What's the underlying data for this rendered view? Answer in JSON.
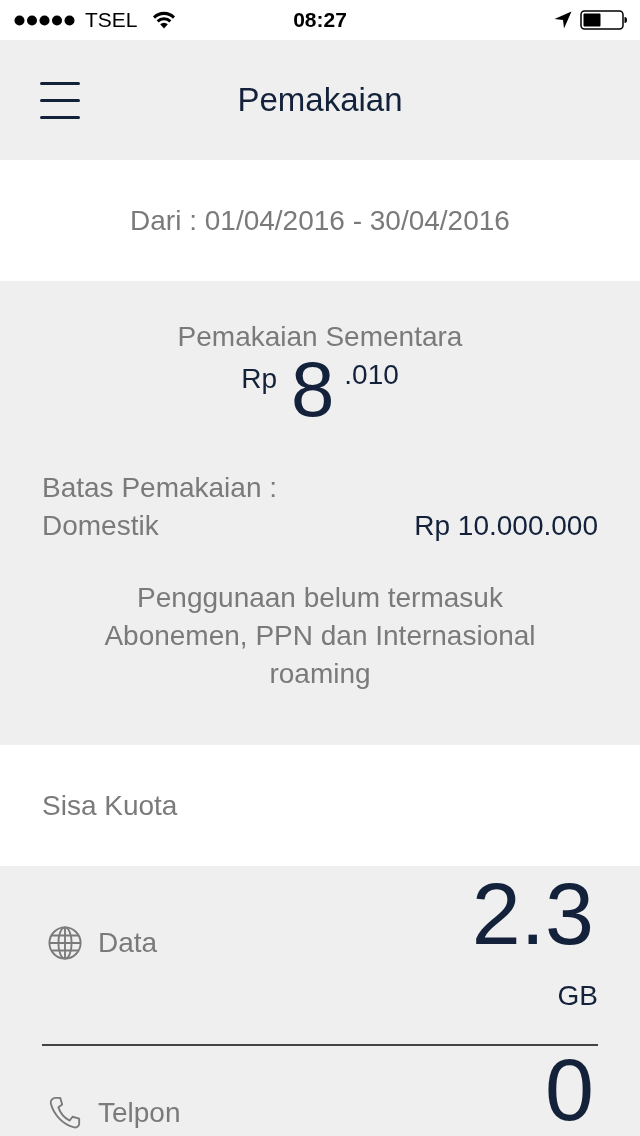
{
  "status_bar": {
    "carrier": "TSEL",
    "time": "08:27"
  },
  "header": {
    "title": "Pemakaian"
  },
  "period": {
    "text": "Dari : 01/04/2016 - 30/04/2016"
  },
  "usage": {
    "title": "Pemakaian Sementara",
    "currency": "Rp",
    "amount_main": "8",
    "amount_rest": ".010",
    "limit_label": "Batas Pemakaian :",
    "limit_type": "Domestik",
    "limit_value": "Rp 10.000.000",
    "note": "Penggunaan belum termasuk Abonemen, PPN dan Internasional roaming"
  },
  "quota": {
    "title": "Sisa Kuota",
    "items": [
      {
        "kind": "data",
        "label": "Data",
        "value": "2.3",
        "unit": "GB"
      },
      {
        "kind": "call",
        "label": "Telpon",
        "value": "0"
      }
    ]
  }
}
